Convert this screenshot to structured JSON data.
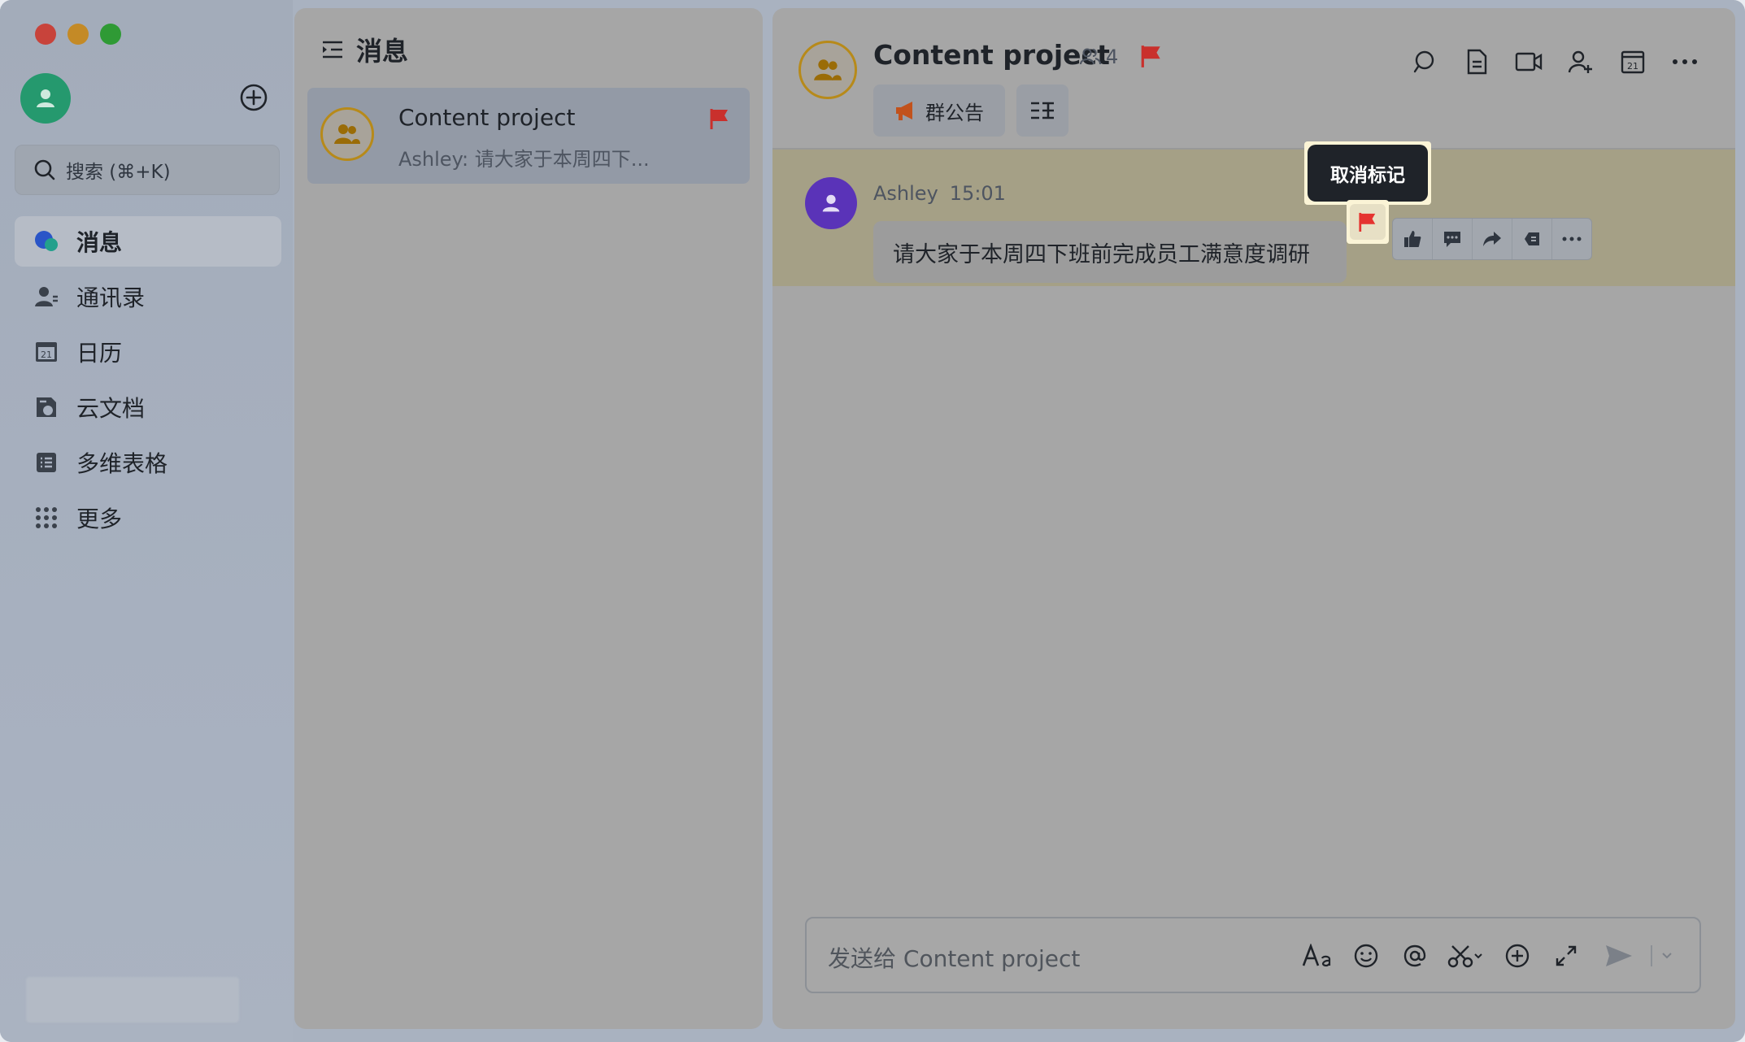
{
  "sidebar": {
    "search_placeholder": "搜索 (⌘+K)",
    "nav": [
      {
        "label": "消息",
        "icon": "message-bubble-icon",
        "active": true
      },
      {
        "label": "通讯录",
        "icon": "contacts-icon"
      },
      {
        "label": "日历",
        "icon": "calendar-icon",
        "day": "21"
      },
      {
        "label": "云文档",
        "icon": "cloud-docs-icon"
      },
      {
        "label": "多维表格",
        "icon": "bitable-icon"
      },
      {
        "label": "更多",
        "icon": "more-grid-icon"
      }
    ]
  },
  "list": {
    "title": "消息",
    "chats": [
      {
        "name": "Content project",
        "preview": "Ashley: 请大家于本周四下...",
        "flagged": true
      }
    ]
  },
  "chat": {
    "title": "Content project",
    "member_count": "4",
    "chips": {
      "notice": "群公告"
    },
    "messages": [
      {
        "sender": "Ashley",
        "time": "15:01",
        "text": "请大家于本周四下班前完成员工满意度调研"
      }
    ],
    "tooltip": "取消标记",
    "composer_placeholder": "发送给 Content project",
    "colors": {
      "flag": "#c9302c",
      "accent": "#b78a1a"
    }
  }
}
